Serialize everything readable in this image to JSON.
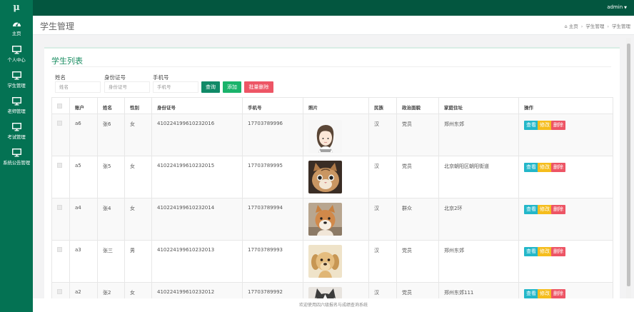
{
  "app": {
    "logo": "μ",
    "user": "admin"
  },
  "nav": [
    {
      "label": "主页",
      "icon": "dashboard-icon"
    },
    {
      "label": "个人中心",
      "icon": "monitor-icon"
    },
    {
      "label": "学生管理",
      "icon": "monitor-icon"
    },
    {
      "label": "老师管理",
      "icon": "monitor-icon"
    },
    {
      "label": "考试管理",
      "icon": "monitor-icon"
    },
    {
      "label": "系统公告管理",
      "icon": "monitor-icon"
    }
  ],
  "header": {
    "title": "学生管理",
    "breadcrumb": [
      "主页",
      "学生管理",
      "学生管理"
    ]
  },
  "panel": {
    "title": "学生列表"
  },
  "search": {
    "name_label": "姓名",
    "name_placeholder": "姓名",
    "id_label": "身份证号",
    "id_placeholder": "身份证号",
    "phone_label": "手机号",
    "phone_placeholder": "手机号",
    "query": "查询",
    "add": "添加",
    "batch_delete": "批量删除"
  },
  "table": {
    "headers": [
      "",
      "账户",
      "姓名",
      "性别",
      "身份证号",
      "手机号",
      "照片",
      "民族",
      "政治面貌",
      "家庭住址",
      "操作"
    ],
    "rows": [
      {
        "account": "a6",
        "name": "张6",
        "gender": "女",
        "idcard": "410224199610232016",
        "phone": "17703789996",
        "photo": "girl",
        "ethnic": "汉",
        "political": "党员",
        "address": "郑州东郊"
      },
      {
        "account": "a5",
        "name": "张5",
        "gender": "女",
        "idcard": "410224199610232015",
        "phone": "17703789995",
        "photo": "cat",
        "ethnic": "汉",
        "political": "党员",
        "address": "北京朝阳区朝阳街道"
      },
      {
        "account": "a4",
        "name": "张4",
        "gender": "女",
        "idcard": "410224199610232014",
        "phone": "17703789994",
        "photo": "shiba",
        "ethnic": "汉",
        "political": "群众",
        "address": "北京2环"
      },
      {
        "account": "a3",
        "name": "张三",
        "gender": "男",
        "idcard": "410224199610232013",
        "phone": "17703789993",
        "photo": "puppy",
        "ethnic": "汉",
        "political": "党员",
        "address": "郑州东郊"
      },
      {
        "account": "a2",
        "name": "张2",
        "gender": "女",
        "idcard": "410224199610232012",
        "phone": "17703789992",
        "photo": "husky",
        "ethnic": "汉",
        "political": "党员",
        "address": "郑州东郊111"
      }
    ],
    "actions": {
      "view": "查看",
      "edit": "修改",
      "delete": "删除"
    }
  },
  "footer": "欢迎使用四六级报名与成绩查询系统",
  "colors": {
    "sidebar": "#047253",
    "topbar": "#03563f",
    "accent": "#1b8e63"
  }
}
